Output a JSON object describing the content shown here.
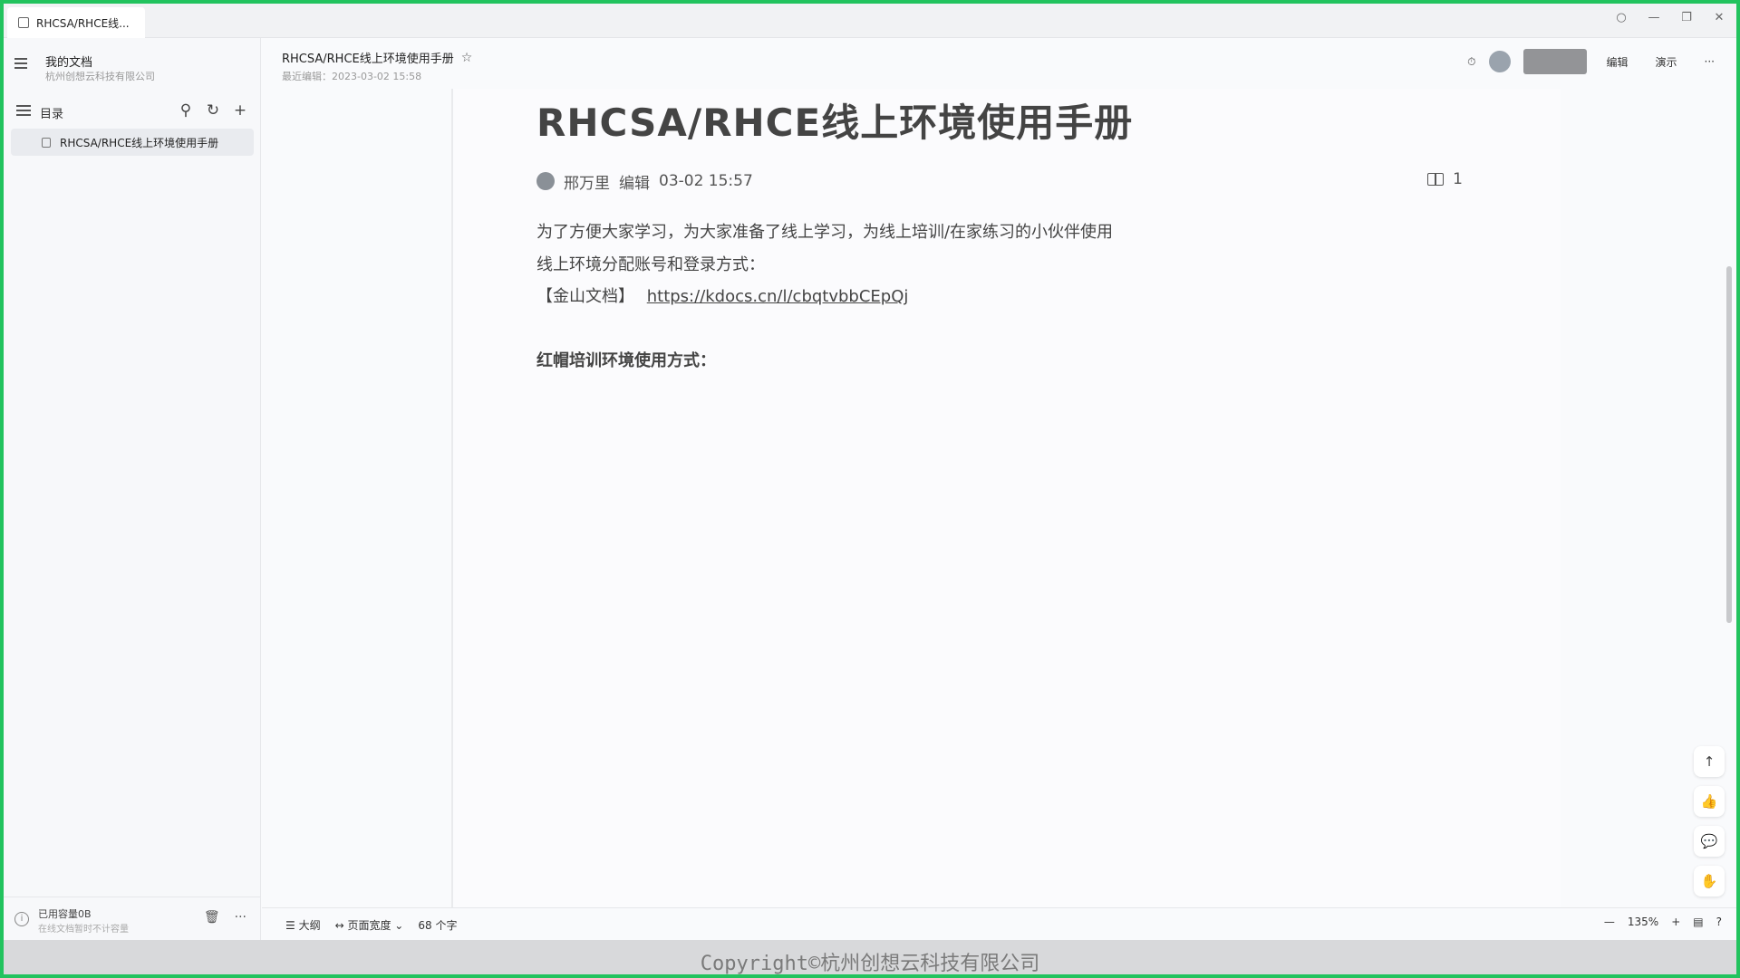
{
  "window": {
    "tab_title": "RHCSA/RHCE线...",
    "controls": [
      "○",
      "—",
      "❐",
      "✕"
    ]
  },
  "sidebar": {
    "space_title": "我的文档",
    "space_subtitle": "杭州创想云科技有限公司",
    "toc_label": "目录",
    "actions": [
      "search-icon",
      "refresh-icon",
      "add-icon"
    ],
    "doc_item": "RHCSA/RHCE线上环境使用手册",
    "storage_used": "已用容量0B",
    "storage_note": "在线文档暂时不计容量"
  },
  "header": {
    "breadcrumb": "RHCSA/RHCE线上环境使用手册",
    "last_edit": "最近编辑：2023-03-02 15:58",
    "edit_btn": "编辑",
    "present_btn": "演示",
    "more": "···"
  },
  "document": {
    "title": "RHCSA/RHCE线上环境使用手册",
    "author": "邢万里",
    "action": "编辑",
    "time": "03-02 15:57",
    "read_count": "1",
    "paragraphs": {
      "p1": "为了方便大家学习，为大家准备了线上学习，为线上培训/在家练习的小伙伴使用",
      "p2": "线上环境分配账号和登录方式：",
      "p3_label": "【金山文档】",
      "p3_link": "https://kdocs.cn/l/cbqtvbbCEpQj",
      "p4": "红帽培训环境使用方式："
    }
  },
  "statusbar": {
    "outline": "大纲",
    "page_width": "页面宽度",
    "word_count": "68 个字",
    "zoom": "135%",
    "zoom_minus": "—",
    "zoom_plus": "+"
  },
  "float_tools": [
    "↑",
    "👍",
    "💬",
    "✋"
  ],
  "footer": {
    "copyright": "Copyright©杭州创想云科技有限公司"
  }
}
